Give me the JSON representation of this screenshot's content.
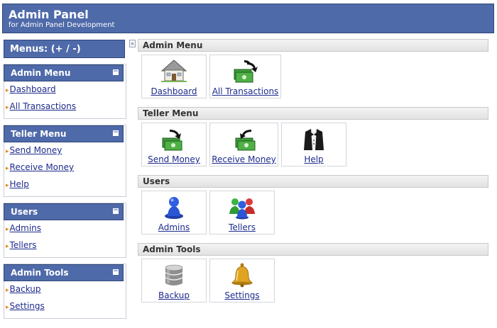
{
  "header": {
    "title": "Admin Panel",
    "subtitle": "for Admin Panel Development"
  },
  "sidebar": {
    "menus_label": "Menus: (+ / -)",
    "collapse_glyph": "«",
    "panels": [
      {
        "title": "Admin Menu",
        "items": [
          "Dashboard",
          "All Transactions"
        ]
      },
      {
        "title": "Teller Menu",
        "items": [
          "Send Money",
          "Receive Money",
          "Help"
        ]
      },
      {
        "title": "Users",
        "items": [
          "Admins",
          "Tellers"
        ]
      },
      {
        "title": "Admin Tools",
        "items": [
          "Backup",
          "Settings"
        ]
      }
    ],
    "minimize_glyph": "−"
  },
  "main": {
    "sections": [
      {
        "title": "Admin Menu",
        "tiles": [
          {
            "label": "Dashboard",
            "icon": "house-icon"
          },
          {
            "label": "All Transactions",
            "icon": "money-transfer-icon"
          }
        ]
      },
      {
        "title": "Teller Menu",
        "tiles": [
          {
            "label": "Send Money",
            "icon": "send-money-icon"
          },
          {
            "label": "Receive Money",
            "icon": "receive-money-icon"
          },
          {
            "label": "Help",
            "icon": "tuxedo-icon"
          }
        ]
      },
      {
        "title": "Users",
        "tiles": [
          {
            "label": "Admins",
            "icon": "admin-user-icon"
          },
          {
            "label": "Tellers",
            "icon": "users-group-icon"
          }
        ]
      },
      {
        "title": "Admin Tools",
        "tiles": [
          {
            "label": "Backup",
            "icon": "database-icon"
          },
          {
            "label": "Settings",
            "icon": "bell-icon"
          }
        ]
      }
    ]
  },
  "colors": {
    "header_bg": "#4f6aa9",
    "link": "#1e2b8c",
    "bullet": "#e28a13"
  }
}
